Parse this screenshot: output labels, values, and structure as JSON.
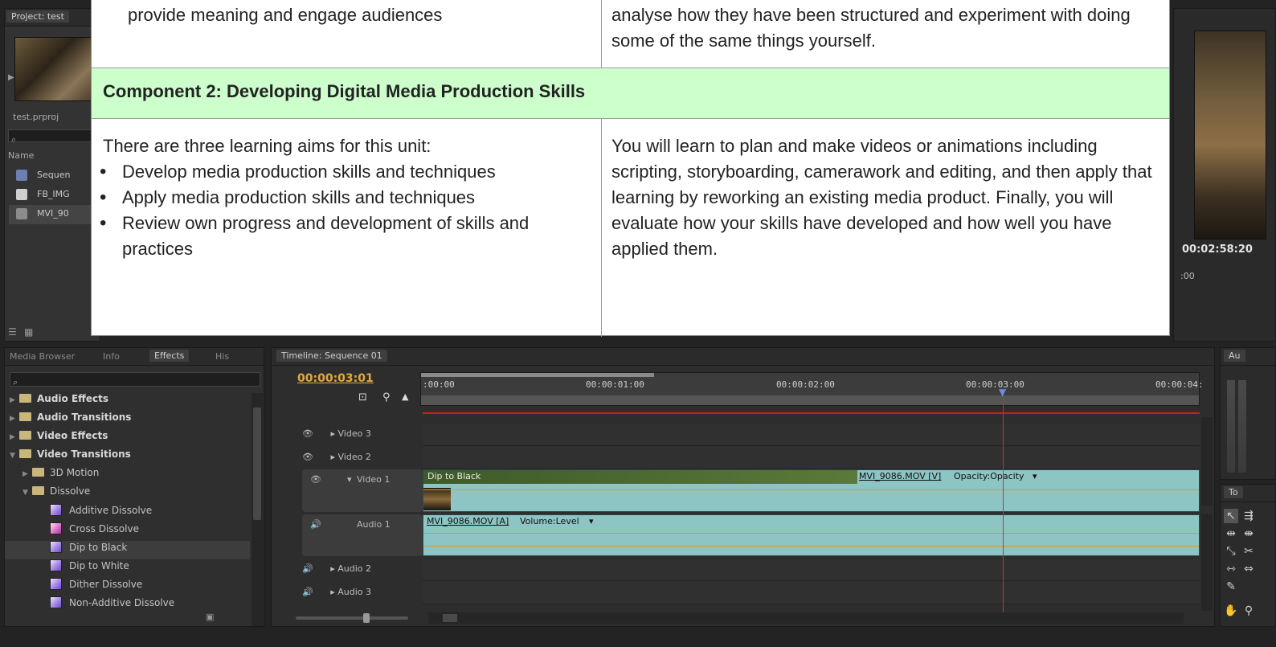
{
  "project": {
    "tab": "Project: test",
    "file": "test.prproj",
    "name_header": "Name",
    "items": [
      "Sequen",
      "FB_IMG",
      "MVI_90"
    ]
  },
  "program": {
    "timecode": "00:02:58:20",
    "sub": ":00"
  },
  "effects": {
    "tabs": [
      "Media Browser",
      "Info",
      "Effects",
      "His"
    ],
    "tree": [
      {
        "label": "Audio Effects",
        "bold": true,
        "level": 0
      },
      {
        "label": "Audio Transitions",
        "bold": true,
        "level": 0
      },
      {
        "label": "Video Effects",
        "bold": true,
        "level": 0
      },
      {
        "label": "Video Transitions",
        "bold": true,
        "level": 0
      },
      {
        "label": "3D Motion",
        "bold": false,
        "level": 1
      },
      {
        "label": "Dissolve",
        "bold": false,
        "level": 1
      },
      {
        "label": "Additive Dissolve",
        "bold": false,
        "level": 2
      },
      {
        "label": "Cross Dissolve",
        "bold": false,
        "level": 2
      },
      {
        "label": "Dip to Black",
        "bold": false,
        "level": 2
      },
      {
        "label": "Dip to White",
        "bold": false,
        "level": 2
      },
      {
        "label": "Dither Dissolve",
        "bold": false,
        "level": 2
      },
      {
        "label": "Non-Additive Dissolve",
        "bold": false,
        "level": 2
      }
    ]
  },
  "timeline": {
    "tab": "Timeline: Sequence 01",
    "timecode": "00:00:03:01",
    "ruler": [
      ":00:00",
      "00:00:01:00",
      "00:00:02:00",
      "00:00:03:00",
      "00:00:04:"
    ],
    "tracks": [
      "Video 3",
      "Video 2",
      "Video 1",
      "Audio 1",
      "Audio 2",
      "Audio 3"
    ],
    "transition_label": "Dip to Black",
    "video_clip": "MVI_9086.MOV [V]",
    "video_opacity": "Opacity:Opacity",
    "audio_clip": "MVI_9086.MOV [A]",
    "audio_volume": "Volume:Level"
  },
  "meters_tab": "Au",
  "tools_tab": "To",
  "document": {
    "top_left": "provide meaning and engage audiences",
    "top_right": "analyse how they have been structured and experiment with doing some of the same things yourself.",
    "heading": "Component 2: Developing Digital Media Production Skills",
    "aims_intro": "There are three learning aims for this unit:",
    "aims": [
      "Develop media production skills and techniques",
      "Apply media production skills and techniques",
      "Review own progress and development of skills and practices"
    ],
    "description": "You will learn to plan and make videos or animations including scripting, storyboarding, camerawork and editing, and then apply that learning by reworking an existing media product. Finally, you will evaluate how your skills have developed and how well you have applied them."
  }
}
